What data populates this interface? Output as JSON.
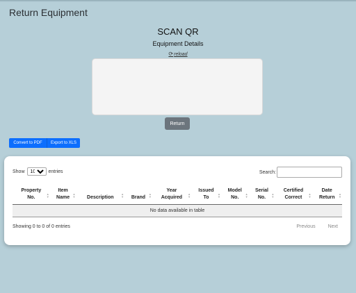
{
  "page": {
    "title": "Return Equipment"
  },
  "scanner": {
    "title": "SCAN QR",
    "subtitle": "Equipment Details",
    "reload_icon": "refresh-icon",
    "reload_label": "reload",
    "return_label": "Return"
  },
  "export": {
    "pdf_label": "Convert to PDF",
    "xls_label": "Export to XLS"
  },
  "table": {
    "show_label": "Show",
    "entries_value": "10",
    "entries_label": "entries",
    "search_label": "Search:",
    "search_value": "",
    "columns": [
      {
        "l1": "Property",
        "l2": "No."
      },
      {
        "l1": "Item",
        "l2": "Name"
      },
      {
        "l1": "",
        "l2": "Description"
      },
      {
        "l1": "",
        "l2": "Brand"
      },
      {
        "l1": "Year",
        "l2": "Acquired"
      },
      {
        "l1": "Issued",
        "l2": "To"
      },
      {
        "l1": "Model",
        "l2": "No."
      },
      {
        "l1": "Serial",
        "l2": "No."
      },
      {
        "l1": "Certified",
        "l2": "Correct"
      },
      {
        "l1": "Date",
        "l2": "Return"
      }
    ],
    "empty_message": "No data available in table",
    "info": "Showing 0 to 0 of 0 entries",
    "prev_label": "Previous",
    "next_label": "Next"
  },
  "colors": {
    "background": "#b6cfd8",
    "primary": "#0d6efd",
    "secondary": "#6c757d"
  }
}
